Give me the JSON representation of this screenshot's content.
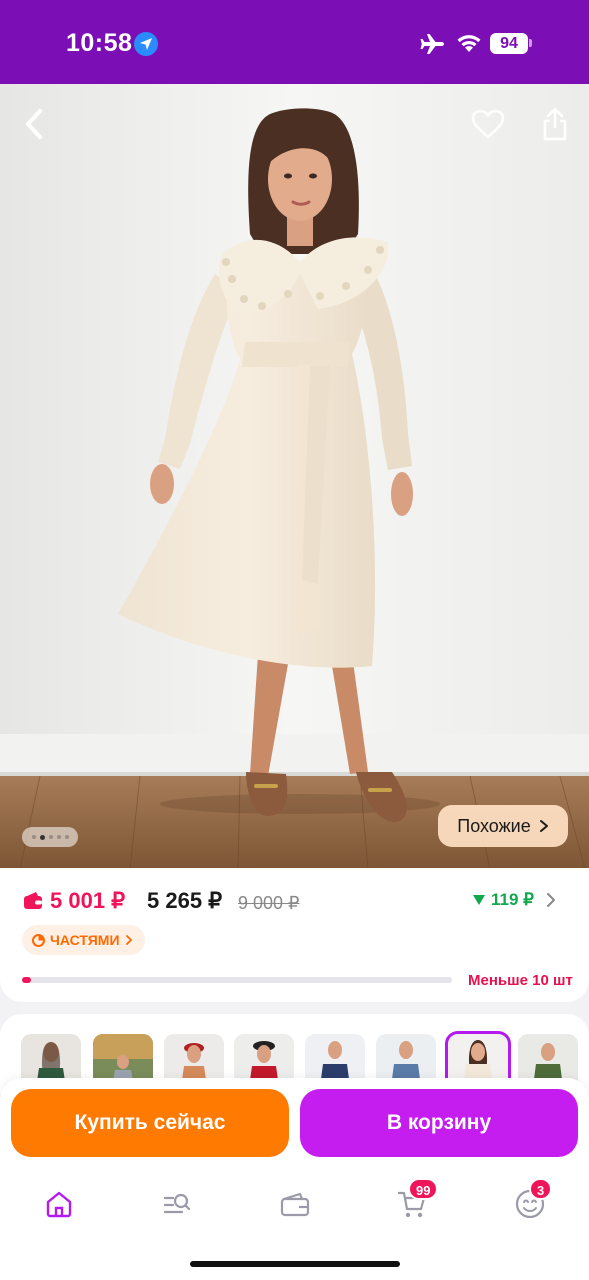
{
  "status_bar": {
    "time": "10:58",
    "battery": "94",
    "icons": [
      "location-arrow-icon",
      "airplane-icon",
      "wifi-icon",
      "battery-icon"
    ]
  },
  "photo": {
    "icons": [
      "back-chevron-icon",
      "heart-icon",
      "share-icon"
    ],
    "gallery_dots": 5,
    "gallery_active_index": 1,
    "similar_label": "Похожие"
  },
  "price": {
    "main": "5 001 ₽",
    "second": "5 265 ₽",
    "old": "9 000 ₽",
    "points": "119 ₽",
    "installments_label": "ЧАСТЯМИ",
    "stock_progress_percent": 2,
    "stock_note": "Меньше 10 шт",
    "colors": {
      "main": "#f0145a",
      "points": "#13a84e",
      "installments": "#ff6a00"
    }
  },
  "thumbnails": {
    "count": 8,
    "selected_index": 6
  },
  "actions": {
    "buy_now": "Купить сейчас",
    "to_cart": "В корзину",
    "colors": {
      "buy_now": "#ff7a00",
      "to_cart": "#c51cf0"
    }
  },
  "tab_bar": {
    "cart_badge": "99",
    "profile_badge": "3",
    "icons": [
      "home-icon",
      "catalog-search-icon",
      "wallet-icon",
      "cart-icon",
      "profile-icon"
    ]
  }
}
